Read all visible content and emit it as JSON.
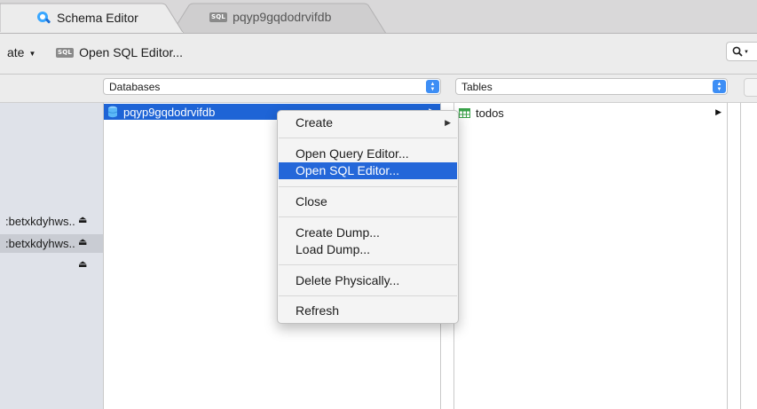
{
  "tabs": [
    {
      "label": "Schema Editor",
      "active": true,
      "icon": "schema-editor-icon"
    },
    {
      "label": "pqyp9gqdodrvifdb",
      "active": false,
      "icon_text": "SQL"
    }
  ],
  "toolbar": {
    "create_label": "ate",
    "open_sql_icon_text": "SQL",
    "open_sql_label": "Open SQL Editor...",
    "search_glyph": "Q"
  },
  "columns": {
    "databases_label": "Databases",
    "tables_label": "Tables"
  },
  "connections": [
    {
      "label": ":betxkdyhws..",
      "selected": false
    },
    {
      "label": ":betxkdyhws..",
      "selected": true
    }
  ],
  "databases": [
    {
      "name": "pqyp9gqdodrvifdb",
      "selected": true
    }
  ],
  "tables": [
    {
      "name": "todos"
    }
  ],
  "context_menu": {
    "items": [
      {
        "label": "Create",
        "has_submenu": true
      },
      {
        "label": "Open Query Editor..."
      },
      {
        "label": "Open SQL Editor...",
        "highlighted": true
      },
      {
        "label": "Close"
      },
      {
        "label": "Create Dump..."
      },
      {
        "label": "Load Dump..."
      },
      {
        "label": "Delete Physically..."
      },
      {
        "label": "Refresh"
      }
    ]
  },
  "colors": {
    "selection_blue": "#1e64d6",
    "menu_highlight": "#2467d9",
    "stepper_blue": "#3d8ef5",
    "sidebar_bg": "#dfe2e9"
  }
}
